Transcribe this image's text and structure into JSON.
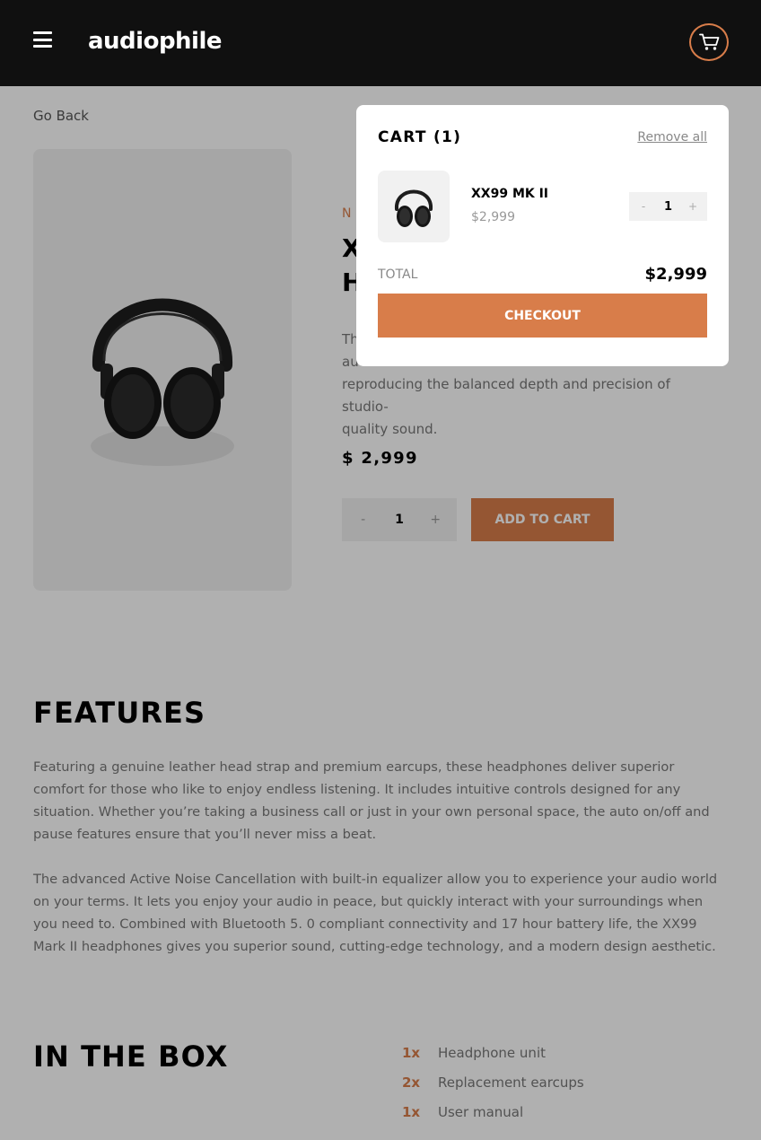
{
  "header": {
    "logo": "audiophile",
    "accent_color": "#d87d4a",
    "menu_icon": "hamburger-icon",
    "cart_icon": "cart-icon"
  },
  "product": {
    "back_label": "Go Back",
    "new_label": "N",
    "title_line1": "X",
    "title_line2": "H",
    "description": [
      "Th",
      "audi",
      "reproducing the balanced depth and precision of studio-",
      "quality sound."
    ],
    "price": "$ 2,999",
    "quantity": "1",
    "minus": "-",
    "plus": "+",
    "add_to_cart": "ADD TO CART"
  },
  "features": {
    "title": "FEATURES",
    "paragraph1": "Featuring a genuine leather head strap and premium earcups, these headphones deliver superior comfort for those who like to enjoy endless listening. It includes intuitive controls designed for any situation. Whether you’re taking a business call or just in your own personal space, the auto on/off and pause features ensure that you’ll never miss a beat.",
    "paragraph2": "The advanced Active Noise Cancellation with built-in equalizer allow you to experience your audio world on your terms. It lets you enjoy your audio in peace, but quickly interact with your surroundings when you need to. Combined with Bluetooth 5. 0 compliant connectivity and 17 hour battery life, the XX99 Mark II headphones gives you superior sound, cutting-edge technology, and a modern design aesthetic."
  },
  "in_the_box": {
    "title": "IN THE BOX",
    "items": [
      {
        "qty": "1x",
        "name": "Headphone unit"
      },
      {
        "qty": "2x",
        "name": "Replacement earcups"
      },
      {
        "qty": "1x",
        "name": "User manual"
      }
    ]
  },
  "cart": {
    "title": "CART (1)",
    "remove_all": "Remove all",
    "item": {
      "name": "XX99 MK II",
      "price": "$2,999",
      "quantity": "1",
      "minus": "-",
      "plus": "+"
    },
    "total_label": "TOTAL",
    "total_value": "$2,999",
    "checkout": "CHECKOUT"
  }
}
